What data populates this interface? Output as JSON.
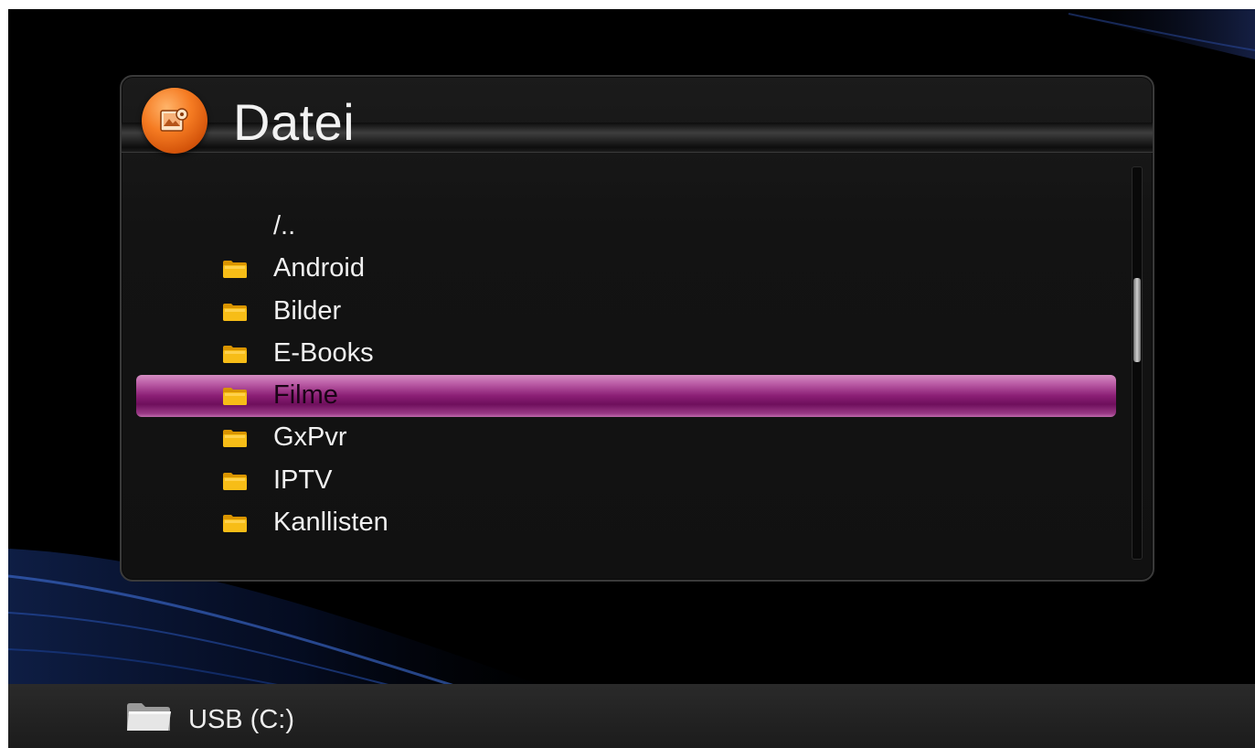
{
  "header": {
    "title": "Datei",
    "icon": "image-file-icon",
    "icon_color": "#f57b22"
  },
  "file_list": {
    "items": [
      {
        "label": "/..",
        "type": "parent",
        "selected": false
      },
      {
        "label": "Android",
        "type": "folder",
        "selected": false
      },
      {
        "label": "Bilder",
        "type": "folder",
        "selected": false
      },
      {
        "label": "E-Books",
        "type": "folder",
        "selected": false
      },
      {
        "label": "Filme",
        "type": "folder",
        "selected": true
      },
      {
        "label": "GxPvr",
        "type": "folder",
        "selected": false
      },
      {
        "label": "IPTV",
        "type": "folder",
        "selected": false
      },
      {
        "label": "Kanllisten",
        "type": "folder",
        "selected": false
      }
    ],
    "selection_color": "#8a1e74",
    "folder_icon_color": "#f5b800"
  },
  "footer": {
    "device_label": "USB (C:)",
    "icon": "folder-icon"
  }
}
